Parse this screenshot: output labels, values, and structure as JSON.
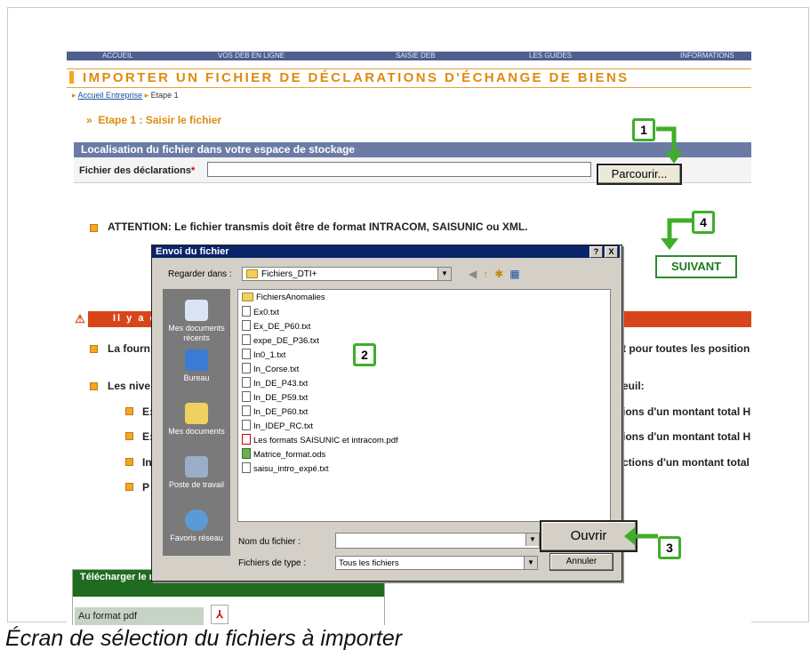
{
  "caption": "Écran de sélection du fichiers à importer",
  "nav": [
    "ACCUEIL",
    "VOS DEB EN LIGNE",
    "SAISIE DEB",
    "LES GUIDES",
    "INFORMATIONS"
  ],
  "page_title": "IMPORTER UN FICHIER DE DÉCLARATIONS D'ÉCHANGE DE BIENS",
  "breadcrumb": {
    "link": "Accueil Entreprise",
    "current": "Etape 1"
  },
  "step_heading": "Etape 1 : Saisir le fichier",
  "section_bar": "Localisation du fichier dans votre espace de stockage",
  "file_field_label": "Fichier des déclarations",
  "browse_button": "Parcourir...",
  "attention_text": "ATTENTION: Le fichier transmis doit être de format INTRACOM, SAISUNIC ou XML.",
  "next_button": "SUIVANT",
  "alert_text": "Il y a d",
  "content_lines": {
    "l1_left": "La fourn",
    "l1_right": "t pour toutes les position",
    "l2_left": "Les nive",
    "l2_right": "euil:",
    "b1_left": "E:",
    "b1_right": "ions d'un montant total H",
    "b2_left": "E:",
    "b2_right": "ions d'un montant total H",
    "b3_left": "In",
    "b3_right": "ctions d'un montant total",
    "b4_left": "P"
  },
  "manual": {
    "header": "Télécharger le manuel utilisateur du DTI+ (Intracom et Saisunic)",
    "pdf_label": "Au format pdf"
  },
  "dialog": {
    "title": "Envoi du fichier",
    "help": "?",
    "close": "X",
    "look_in_label": "Regarder dans :",
    "look_in_value": "Fichiers_DTI+",
    "places": [
      "Mes documents récents",
      "Bureau",
      "Mes documents",
      "Poste de travail",
      "Favoris réseau"
    ],
    "files": [
      {
        "name": "FichiersAnomalies",
        "type": "folder"
      },
      {
        "name": "Ex0.txt",
        "type": "txt"
      },
      {
        "name": "Ex_DE_P60.txt",
        "type": "txt"
      },
      {
        "name": "expe_DE_P36.txt",
        "type": "txt"
      },
      {
        "name": "In0_1.txt",
        "type": "txt"
      },
      {
        "name": "In_Corse.txt",
        "type": "txt"
      },
      {
        "name": "In_DE_P43.txt",
        "type": "txt"
      },
      {
        "name": "In_DE_P59.txt",
        "type": "txt"
      },
      {
        "name": "In_DE_P60.txt",
        "type": "txt"
      },
      {
        "name": "In_IDEP_RC.txt",
        "type": "txt"
      },
      {
        "name": "Les formats SAISUNIC et intracom.pdf",
        "type": "pdf"
      },
      {
        "name": "Matrice_format.ods",
        "type": "ods"
      },
      {
        "name": "saisu_intro_expé.txt",
        "type": "txt"
      }
    ],
    "filename_label": "Nom du fichier :",
    "filename_value": "",
    "filetype_label": "Fichiers de type :",
    "filetype_value": "Tous les fichiers",
    "open_button": "Ouvrir",
    "cancel_button": "Annuler"
  },
  "callouts": [
    "1",
    "2",
    "3",
    "4"
  ],
  "colors": {
    "accent_orange": "#e08a10",
    "callout_green": "#3fae2a",
    "nav_blue": "#4e5f8f",
    "alert_red": "#d9451a"
  }
}
